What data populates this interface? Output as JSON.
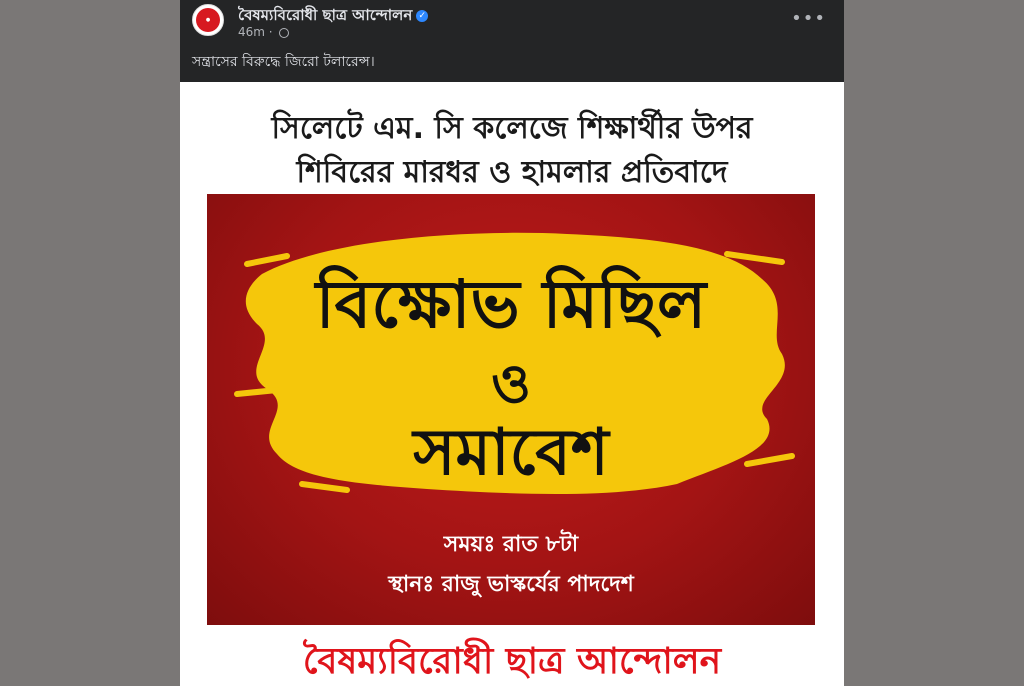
{
  "post": {
    "page_name": "বৈষম্যবিরোধী ছাত্র আন্দোলন",
    "timestamp": "46m",
    "separator": "·",
    "more_label": "•••",
    "caption": "সন্ত্রাসের বিরুদ্ধে জিরো টলারেন্স।"
  },
  "poster": {
    "headline_line1": "সিলেটে এম. সি কলেজে শিক্ষার্থীর উপর",
    "headline_line2": "শিবিরের মারধর ও হামলার প্রতিবাদে",
    "title_line1": "বিক্ষোভ মিছিল",
    "title_line2": "ও",
    "title_line3": "সমাবেশ",
    "time_text": "সময়ঃ রাত ৮টা",
    "place_text": "স্থানঃ রাজু ভাস্কর্যের পাদদেশ",
    "footer_org": "বৈষম্যবিরোধী ছাত্র আন্দোলন"
  },
  "colors": {
    "page_bg": "#7a7776",
    "post_bg": "#242526",
    "banner_red": "#a31414",
    "brush_yellow": "#f5c70b",
    "footer_red": "#e0141b",
    "verified_blue": "#2d88ff"
  },
  "icons": {
    "verified": "verified-badge-icon",
    "audience": "globe-icon",
    "more": "more-options-icon"
  }
}
